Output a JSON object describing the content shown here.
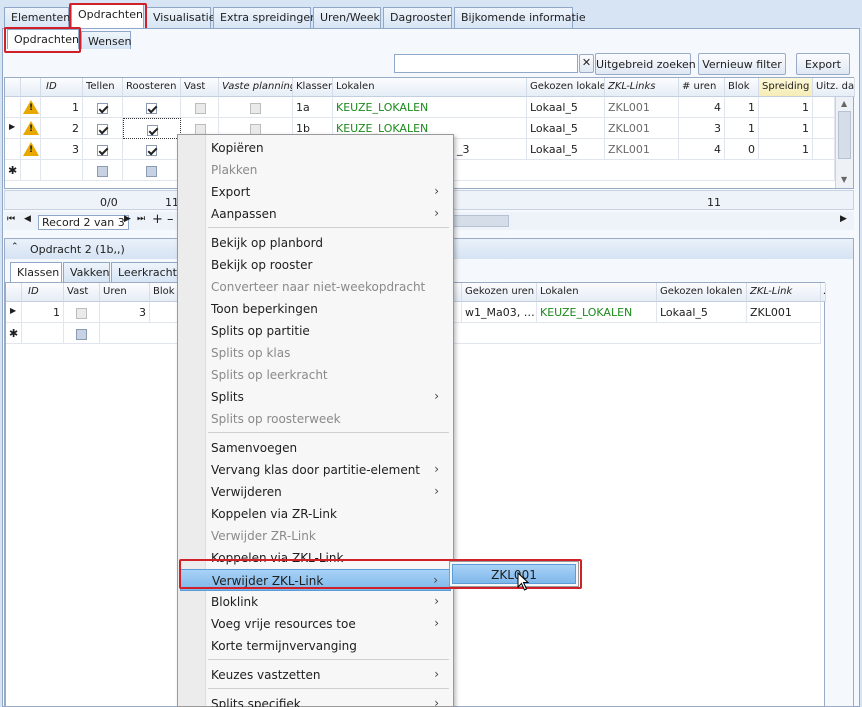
{
  "main_tabs": [
    "Elementen",
    "Opdrachten",
    "Visualisatie",
    "Extra spreidingen",
    "Uren/Week",
    "Dagrooster",
    "Bijkomende informatie"
  ],
  "sub_tabs": [
    "Opdrachten",
    "Wensen"
  ],
  "toolbar": {
    "search_value": "",
    "clear_label": "✕",
    "advanced_search": "Uitgebreid zoeken",
    "refresh_filter": "Vernieuw filter",
    "export": "Export"
  },
  "top_grid": {
    "columns": [
      "ID",
      "Tellen",
      "Roosteren",
      "Vast",
      "Vaste planning",
      "Klassen",
      "Lokalen",
      "Gekozen lokalen",
      "ZKL-Links",
      "# uren",
      "Blok",
      "Spreiding",
      "Uitz. dag"
    ],
    "rows": [
      {
        "id": "1",
        "klassen": "1a",
        "lokalen": "KEUZE_LOKALEN",
        "gekozen": "Lokaal_5",
        "zkl": "ZKL001",
        "uren": "4",
        "blok": "1",
        "spreiding": "1"
      },
      {
        "id": "2",
        "klassen": "1b",
        "lokalen": "KEUZE_LOKALEN",
        "gekozen": "Lokaal_5",
        "zkl": "ZKL001",
        "uren": "3",
        "blok": "1",
        "spreiding": "1"
      },
      {
        "id": "3",
        "klassen": "",
        "lokalen": "_3",
        "gekozen": "Lokaal_5",
        "zkl": "ZKL001",
        "uren": "4",
        "blok": "0",
        "spreiding": "1"
      }
    ],
    "footer": {
      "count": "0/0",
      "c2": "11",
      "c3": "11"
    },
    "navigator": "Record 2 van 3"
  },
  "detail": {
    "title": "Opdracht 2 (1b,,)",
    "tabs": [
      "Klassen",
      "Vakken",
      "Leerkrachte"
    ],
    "columns": [
      "ID",
      "Vast",
      "Uren",
      "Blok",
      "Gekozen uren",
      "Lokalen",
      "Gekozen lokalen",
      "ZKL-Link",
      "ZR-"
    ],
    "row": {
      "id": "1",
      "uren": "3",
      "gekozen_uren": "w1_Ma03, …",
      "lokalen": "KEUZE_LOKALEN",
      "gekozen_lokalen": "Lokaal_5",
      "zkl": "ZKL001"
    }
  },
  "context_menu": {
    "items": [
      {
        "label": "Kopiëren",
        "disabled": false,
        "sub": false
      },
      {
        "label": "Plakken",
        "disabled": true,
        "sub": false
      },
      {
        "label": "Export",
        "disabled": false,
        "sub": true
      },
      {
        "label": "Aanpassen",
        "disabled": false,
        "sub": true
      },
      {
        "label": "Bekijk op planbord",
        "disabled": false,
        "sub": false
      },
      {
        "label": "Bekijk op rooster",
        "disabled": false,
        "sub": false
      },
      {
        "label": "Converteer naar niet-weekopdracht",
        "disabled": true,
        "sub": false
      },
      {
        "label": "Toon beperkingen",
        "disabled": false,
        "sub": false
      },
      {
        "label": "Splits op partitie",
        "disabled": false,
        "sub": false
      },
      {
        "label": "Splits op klas",
        "disabled": true,
        "sub": false
      },
      {
        "label": "Splits op leerkracht",
        "disabled": true,
        "sub": false
      },
      {
        "label": "Splits",
        "disabled": false,
        "sub": true
      },
      {
        "label": "Splits op roosterweek",
        "disabled": true,
        "sub": false
      },
      {
        "label": "Samenvoegen",
        "disabled": false,
        "sub": false
      },
      {
        "label": "Vervang klas door partitie-element",
        "disabled": false,
        "sub": true
      },
      {
        "label": "Verwijderen",
        "disabled": false,
        "sub": true
      },
      {
        "label": "Koppelen via ZR-Link",
        "disabled": false,
        "sub": false
      },
      {
        "label": "Verwijder ZR-Link",
        "disabled": true,
        "sub": false
      },
      {
        "label": "Koppelen via ZKL-Link",
        "disabled": false,
        "sub": false
      },
      {
        "label": "Verwijder ZKL-Link",
        "disabled": false,
        "sub": true,
        "highlighted": true
      },
      {
        "label": "Bloklink",
        "disabled": false,
        "sub": true
      },
      {
        "label": "Voeg vrije resources toe",
        "disabled": false,
        "sub": true
      },
      {
        "label": "Korte termijnvervanging",
        "disabled": false,
        "sub": false
      },
      {
        "label": "Keuzes vastzetten",
        "disabled": false,
        "sub": true
      },
      {
        "label": "Splits specifiek",
        "disabled": false,
        "sub": true
      }
    ],
    "submenu_item": "ZKL001"
  },
  "colors": {
    "highlight": "#7fb7ea",
    "annotation_red": "#d0202a",
    "link_green": "#1c8a1c"
  }
}
